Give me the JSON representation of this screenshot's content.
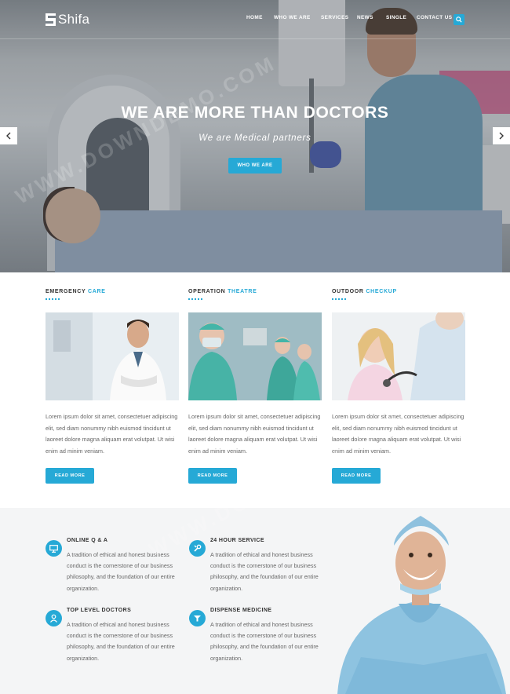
{
  "brand": {
    "name": "Shifa",
    "accent": "#26a9d6"
  },
  "nav": {
    "items": [
      "HOME",
      "WHO WE ARE",
      "SERVICES",
      "NEWS",
      "SINGLE",
      "CONTACT US"
    ],
    "search_icon": "search-icon"
  },
  "hero": {
    "title": "WE ARE MORE THAN DOCTORS",
    "subtitle": "We are Medical partners",
    "button": "WHO WE ARE",
    "prev_icon": "chevron-left-icon",
    "next_icon": "chevron-right-icon"
  },
  "services": [
    {
      "title_main": "EMERGENCY",
      "title_accent": "CARE",
      "text": "Lorem ipsum dolor sit amet, consectetuer adipiscing elit, sed diam nonummy nibh euismod tincidunt ut laoreet dolore magna aliquam erat volutpat. Ut wisi enim ad minim veniam.",
      "button": "READ MORE"
    },
    {
      "title_main": "OPERATION",
      "title_accent": "THEATRE",
      "text": "Lorem ipsum dolor sit amet, consectetuer adipiscing elit, sed diam nonummy nibh euismod tincidunt ut laoreet dolore magna aliquam erat volutpat. Ut wisi enim ad minim veniam.",
      "button": "READ MORE"
    },
    {
      "title_main": "OUTDOOR",
      "title_accent": "CHECKUP",
      "text": "Lorem ipsum dolor sit amet, consectetuer adipiscing elit, sed diam nonummy nibh euismod tincidunt ut laoreet dolore magna aliquam erat volutpat. Ut wisi enim ad minim veniam.",
      "button": "READ MORE"
    }
  ],
  "features": [
    {
      "title": "ONLINE Q & A",
      "icon": "monitor-icon",
      "text": "A tradition of ethical and honest business conduct is the cornerstone of our business philosophy, and the foundation of our entire organization."
    },
    {
      "title": "24 HOUR SERVICE",
      "icon": "wrench-icon",
      "text": "A tradition of ethical and honest business conduct is the cornerstone of our business philosophy, and the foundation of our entire organization."
    },
    {
      "title": "TOP LEVEL DOCTORS",
      "icon": "doctor-icon",
      "text": "A tradition of ethical and honest business conduct is the cornerstone of our business philosophy, and the foundation of our entire organization."
    },
    {
      "title": "DISPENSE MEDICINE",
      "icon": "medicine-icon",
      "text": "A tradition of ethical and honest business conduct is the cornerstone of our business philosophy, and the foundation of our entire organization."
    }
  ]
}
